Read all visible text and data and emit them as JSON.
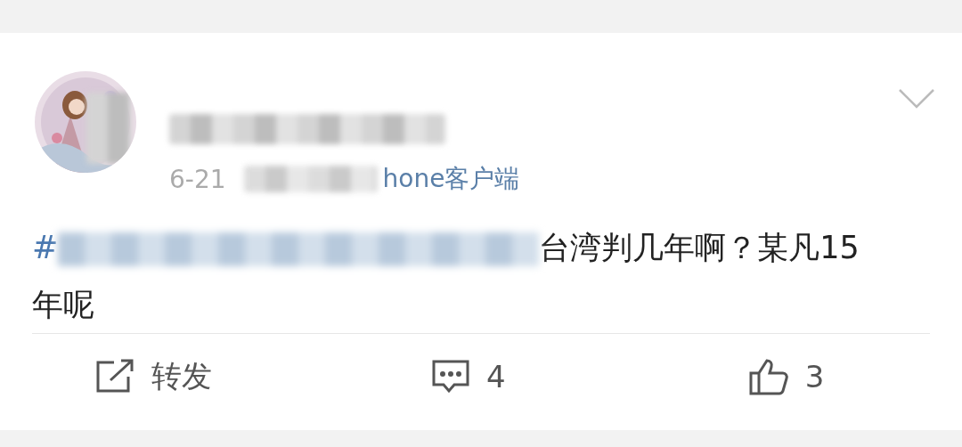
{
  "post": {
    "date": "6-21",
    "source": "hone客户端",
    "hashtag_mark": "#",
    "text": "台湾判几年啊？某凡15年呢"
  },
  "actions": [
    {
      "kind": "repost",
      "label": "转发"
    },
    {
      "kind": "comment",
      "label": "4"
    },
    {
      "kind": "like",
      "label": "3"
    }
  ]
}
